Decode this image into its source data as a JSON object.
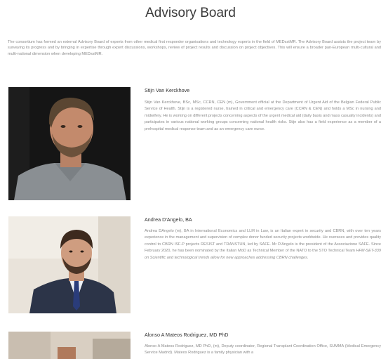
{
  "page": {
    "title": "Advisory Board",
    "intro": "The consortium has formed an external Advisory Board of experts from other medical first responder organisations and technology experts in the field of MEDsstMR. The Advisory Board assists the project team by surveying its progress and by bringing in expertise through expert discussions, workshops, review of project results and discussion on project objectives. This will ensure a broader pan-European multi-cultural and multi-national dimension when developing MEDsstMR."
  },
  "members": [
    {
      "name": "Stijn Van Kerckhove",
      "bio": "Stijn Van Kerckhove, BSc, MSc, CCRN, CEN (m), Government official at the Department of Urgent Aid of the Belgian Federal Public Service of Health. Stijn is a registered nurse, trained in critical and emergency care (CCRN & CEN) and holds a MSc in nursing and midwifery. He is working on different projects concerning aspects of the urgent medical aid (daily basis and mass casualty incidents) and participates in various national working groups concerning national health risks. Stijn also has a field experience as a member of a prehospital medical response team and as an emergency care nurse."
    },
    {
      "name": "Andrea D'Angelo, BA",
      "bio": "Andrea DAngelo (m), BA in International Economics and LLM in Law, is an Italian expert in security and CBRN, with over ten years experience in the management and supervision of complex donor funded security projects worldwide. He oversees and provides quality control to CBRN ISF-P projects RESIST and TRANSTUN, led by SAFE. Mr D'Angelo is the president of the Associazione SAFE. Since February 2020, he has been nominated by the Italian MoD as Technical Member of the NATO to the STO Technical Team",
      "bio_italic": "HFM-SET-339 on Scientific and technological trends allow for new approaches addressing CBRN challenges."
    },
    {
      "name": "Alonso A Mateos Rodriguez, MD PhD",
      "bio": "Alonso A Mateos Rodriguez, MD PhD, (m), Deputy coordinator, Regional Transplant Coordination Office, SUMMA (Medical Emergency Service Madrid). Mateos Rodriguez is a family physician with a"
    }
  ]
}
